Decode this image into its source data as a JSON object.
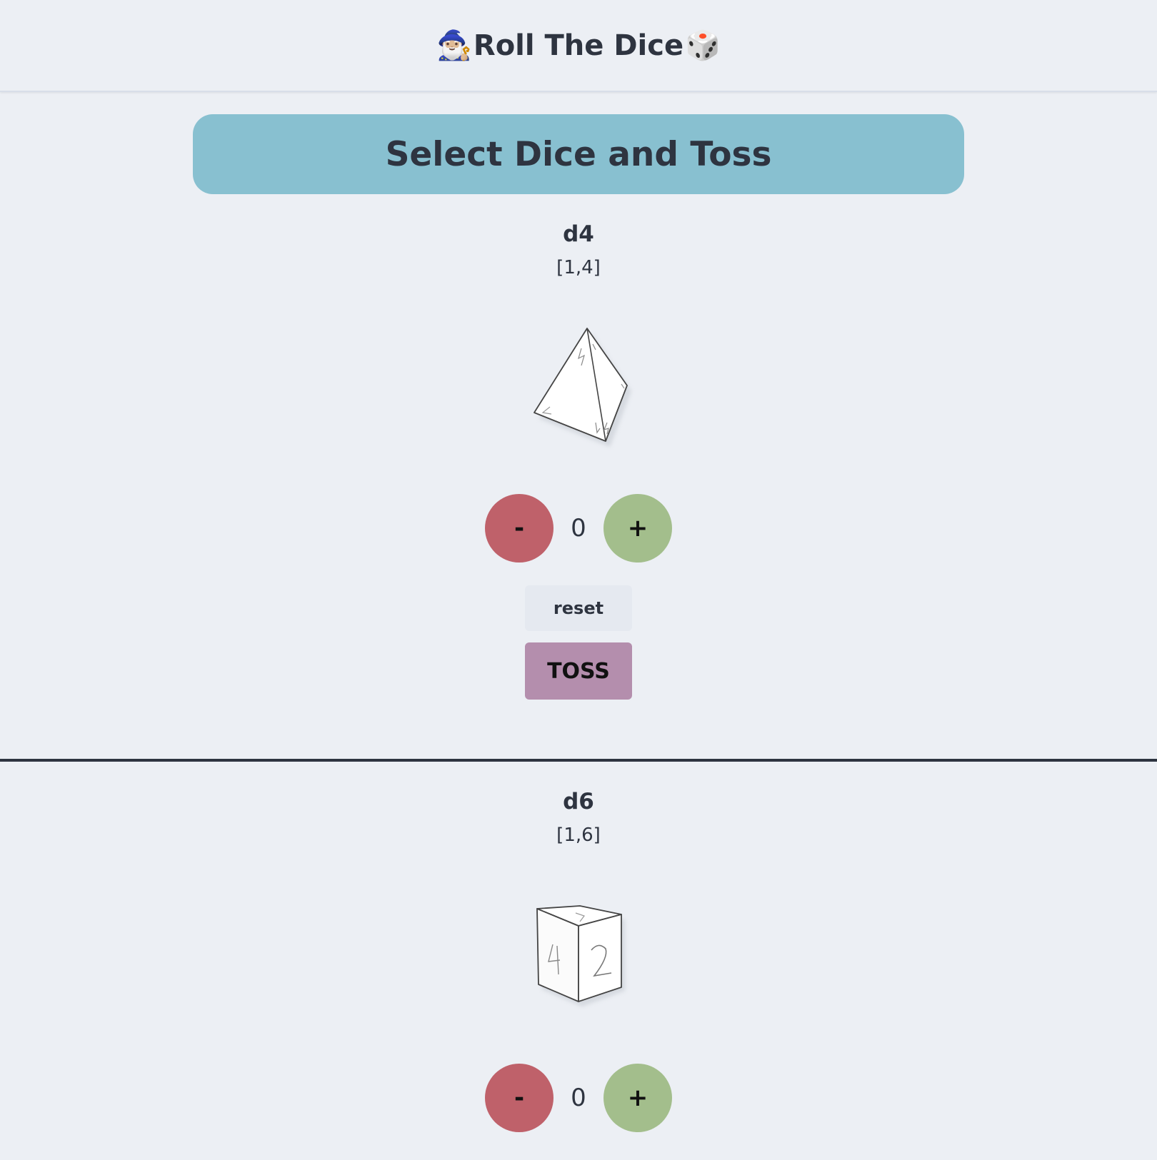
{
  "header": {
    "title": "Roll The Dice",
    "left_icon": "wizard-icon",
    "right_icon": "dice-icon",
    "left_glyph": "🧙🏼‍♂️",
    "right_glyph": "🎲"
  },
  "banner": {
    "title": "Select Dice and Toss"
  },
  "dice": [
    {
      "name": "d4",
      "range": "[1,4]",
      "count": "0",
      "minus_label": "-",
      "plus_label": "+",
      "reset_label": "reset",
      "toss_label": "TOSS"
    },
    {
      "name": "d6",
      "range": "[1,6]",
      "count": "0",
      "minus_label": "-",
      "plus_label": "+"
    }
  ],
  "colors": {
    "background": "#eceff4",
    "banner": "#88c0d0",
    "minus": "#bf616a",
    "plus": "#a3be8c",
    "toss": "#b48ead",
    "text": "#2e3440"
  }
}
